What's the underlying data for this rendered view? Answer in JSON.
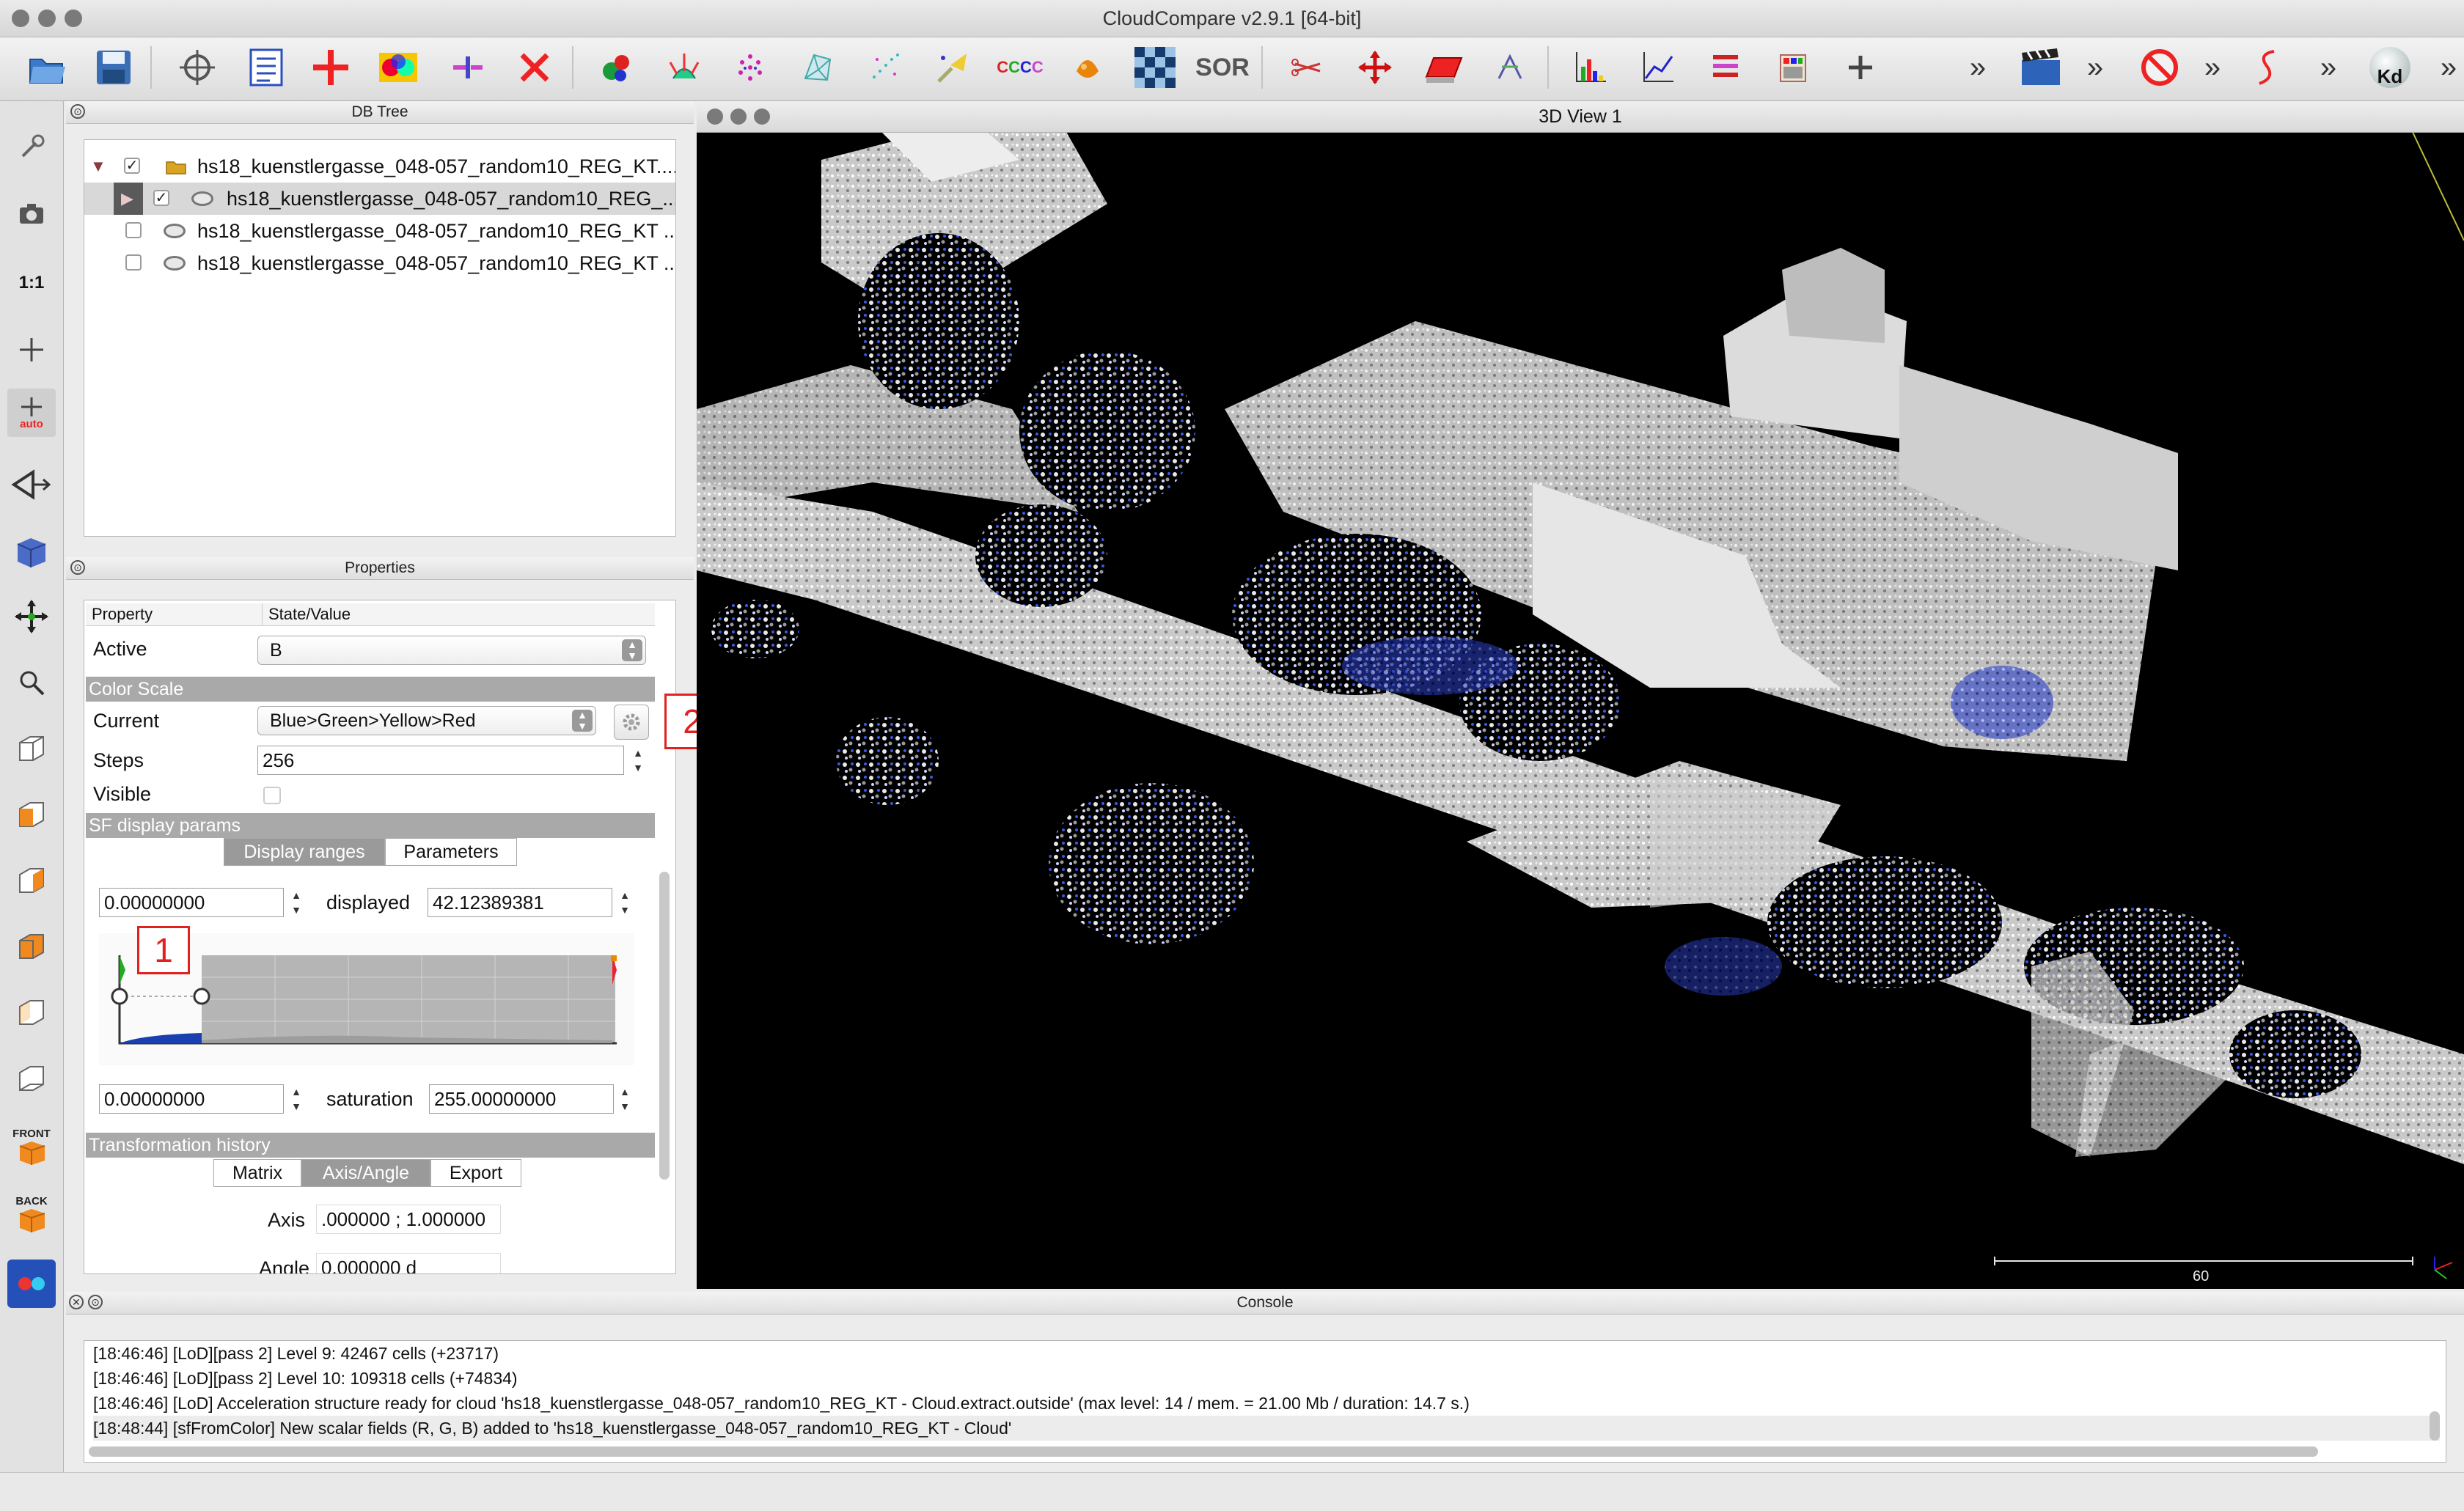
{
  "window": {
    "title": "CloudCompare v2.9.1 [64-bit]"
  },
  "toolbar": {
    "icons": [
      "open-icon",
      "save-icon",
      "point-picking-icon",
      "list-icon",
      "add-point-icon",
      "merge-colors-icon",
      "split-icon",
      "delete-icon",
      "segment-icon",
      "normals-icon",
      "sample-icon",
      "mesh-icon",
      "noise-icon",
      "clean-icon",
      "cc-label",
      "color-icon",
      "checker-icon",
      "sor-label",
      "scissors-icon",
      "translate-icon",
      "plane-icon",
      "registration-icon",
      "histogram-icon",
      "plot-icon",
      "stats-icon",
      "filter-icon",
      "add-icon",
      "more-icon",
      "movie-icon",
      "more-icon-2",
      "stop-icon",
      "more-icon-3",
      "curve-icon",
      "more-icon-4",
      "kd-icon",
      "more-icon-5"
    ],
    "cc_label": "CC\nCC",
    "sor_label": "SOR",
    "kd_label": "Kd",
    "more_label": "»"
  },
  "left_toolbar": {
    "ratio_label": "1:1",
    "auto_label": "auto",
    "front_label": "FRONT",
    "back_label": "BACK"
  },
  "db_tree": {
    "title": "DB Tree",
    "items": [
      {
        "label": "hs18_kuenstlergasse_048-057_random10_REG_KT....",
        "checked": true,
        "expanded": true
      },
      {
        "label": "hs18_kuenstlergasse_048-057_random10_REG_...",
        "checked": true,
        "selected": true
      },
      {
        "label": "hs18_kuenstlergasse_048-057_random10_REG_KT ...",
        "checked": false
      },
      {
        "label": "hs18_kuenstlergasse_048-057_random10_REG_KT ...",
        "checked": false
      }
    ]
  },
  "properties": {
    "title": "Properties",
    "col_property": "Property",
    "col_value": "State/Value",
    "active_label": "Active",
    "active_value": "B",
    "color_scale_header": "Color Scale",
    "current_label": "Current",
    "current_value": "Blue>Green>Yellow>Red",
    "steps_label": "Steps",
    "steps_value": "256",
    "visible_label": "Visible",
    "sf_header": "SF display params",
    "tab_display_ranges": "Display ranges",
    "tab_parameters": "Parameters",
    "displayed_min": "0.00000000",
    "displayed_label": "displayed",
    "displayed_max": "42.12389381",
    "saturation_min": "0.00000000",
    "saturation_label": "saturation",
    "saturation_max": "255.00000000",
    "transform_header": "Transformation history",
    "tab_matrix": "Matrix",
    "tab_axis_angle": "Axis/Angle",
    "tab_export": "Export",
    "axis_label": "Axis",
    "axis_value": ".000000 ; 1.000000",
    "angle_label": "Angle",
    "angle_value": "0.000000 d"
  },
  "annotations": {
    "marker1": "1",
    "marker2": "2"
  },
  "view3d": {
    "title": "3D View 1",
    "scale_label": "60"
  },
  "console": {
    "title": "Console",
    "lines": [
      "[18:46:46] [LoD][pass 2] Level 9: 42467 cells (+23717)",
      "[18:46:46] [LoD][pass 2] Level 10: 109318 cells (+74834)",
      "[18:46:46] [LoD] Acceleration structure ready for cloud 'hs18_kuenstlergasse_048-057_random10_REG_KT - Cloud.extract.outside' (max level: 14 / mem. = 21.00 Mb / duration: 14.7 s.)",
      "[18:48:44] [sfFromColor] New scalar fields (R, G, B) added to 'hs18_kuenstlergasse_048-057_random10_REG_KT - Cloud'"
    ]
  },
  "colors": {
    "accent_red": "#e0211f",
    "section_gray": "#a9a9a9",
    "point_blue": "#3045d8"
  }
}
